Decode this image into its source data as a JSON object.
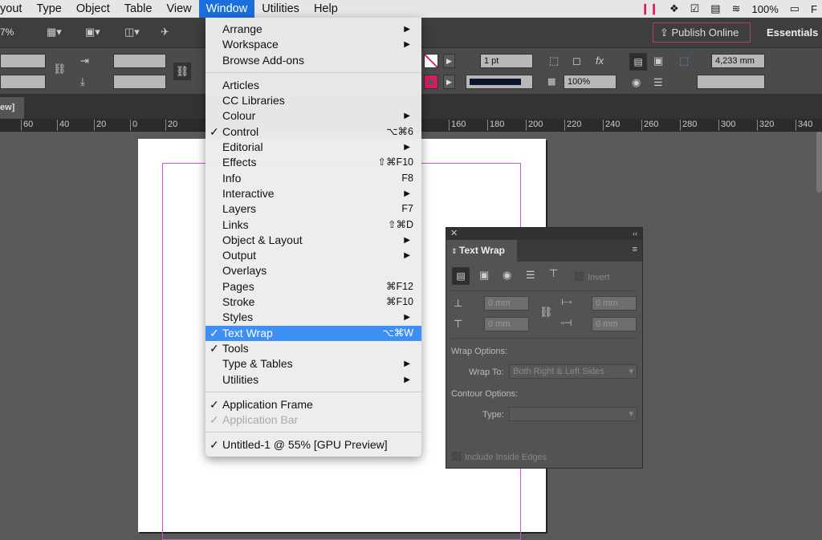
{
  "menubar": {
    "items": [
      "yout",
      "Type",
      "Object",
      "Table",
      "View",
      "Window",
      "Utilities",
      "Help"
    ],
    "active": "Window",
    "status": {
      "battery": "100%",
      "extra": "F"
    }
  },
  "appbar": {
    "zoom": "7%",
    "publish": "Publish Online",
    "workspace": "Essentials"
  },
  "control": {
    "stroke_weight": "1 pt",
    "opacity": "100%",
    "dimension": "4,233 mm",
    "accent": "#d81b60"
  },
  "doc_tab": "ew]",
  "ruler": [
    "60",
    "40",
    "20",
    "0",
    "20",
    "160",
    "180",
    "200",
    "220",
    "240",
    "260",
    "280",
    "300",
    "320",
    "340"
  ],
  "window_menu": {
    "groups": [
      [
        {
          "label": "Arrange",
          "sub": true
        },
        {
          "label": "Workspace",
          "sub": true
        },
        {
          "label": "Browse Add-ons"
        }
      ],
      [
        {
          "label": "Articles"
        },
        {
          "label": "CC Libraries"
        },
        {
          "label": "Colour",
          "sub": true
        },
        {
          "label": "Control",
          "checked": true,
          "shortcut": "⌥⌘6"
        },
        {
          "label": "Editorial",
          "sub": true
        },
        {
          "label": "Effects",
          "shortcut": "⇧⌘F10"
        },
        {
          "label": "Info",
          "shortcut": "F8"
        },
        {
          "label": "Interactive",
          "sub": true
        },
        {
          "label": "Layers",
          "shortcut": "F7"
        },
        {
          "label": "Links",
          "shortcut": "⇧⌘D"
        },
        {
          "label": "Object & Layout",
          "sub": true
        },
        {
          "label": "Output",
          "sub": true
        },
        {
          "label": "Overlays"
        },
        {
          "label": "Pages",
          "shortcut": "⌘F12"
        },
        {
          "label": "Stroke",
          "shortcut": "⌘F10"
        },
        {
          "label": "Styles",
          "sub": true
        },
        {
          "label": "Text Wrap",
          "checked": true,
          "shortcut": "⌥⌘W",
          "highlighted": true
        },
        {
          "label": "Tools",
          "checked": true
        },
        {
          "label": "Type & Tables",
          "sub": true
        },
        {
          "label": "Utilities",
          "sub": true
        }
      ],
      [
        {
          "label": "Application Frame",
          "checked": true
        },
        {
          "label": "Application Bar",
          "checked": true,
          "disabled": true
        }
      ],
      [
        {
          "label": "Untitled-1 @ 55% [GPU Preview]",
          "checked": true
        }
      ]
    ]
  },
  "text_wrap_panel": {
    "title": "Text Wrap",
    "invert": "Invert",
    "top": "0 mm",
    "bottom": "0 mm",
    "left": "0 mm",
    "right": "0 mm",
    "wrap_options": "Wrap Options:",
    "wrap_to_label": "Wrap To:",
    "wrap_to": "Both Right & Left Sides",
    "contour_options": "Contour Options:",
    "type_label": "Type:",
    "type": "",
    "include_inside": "Include Inside Edges"
  }
}
